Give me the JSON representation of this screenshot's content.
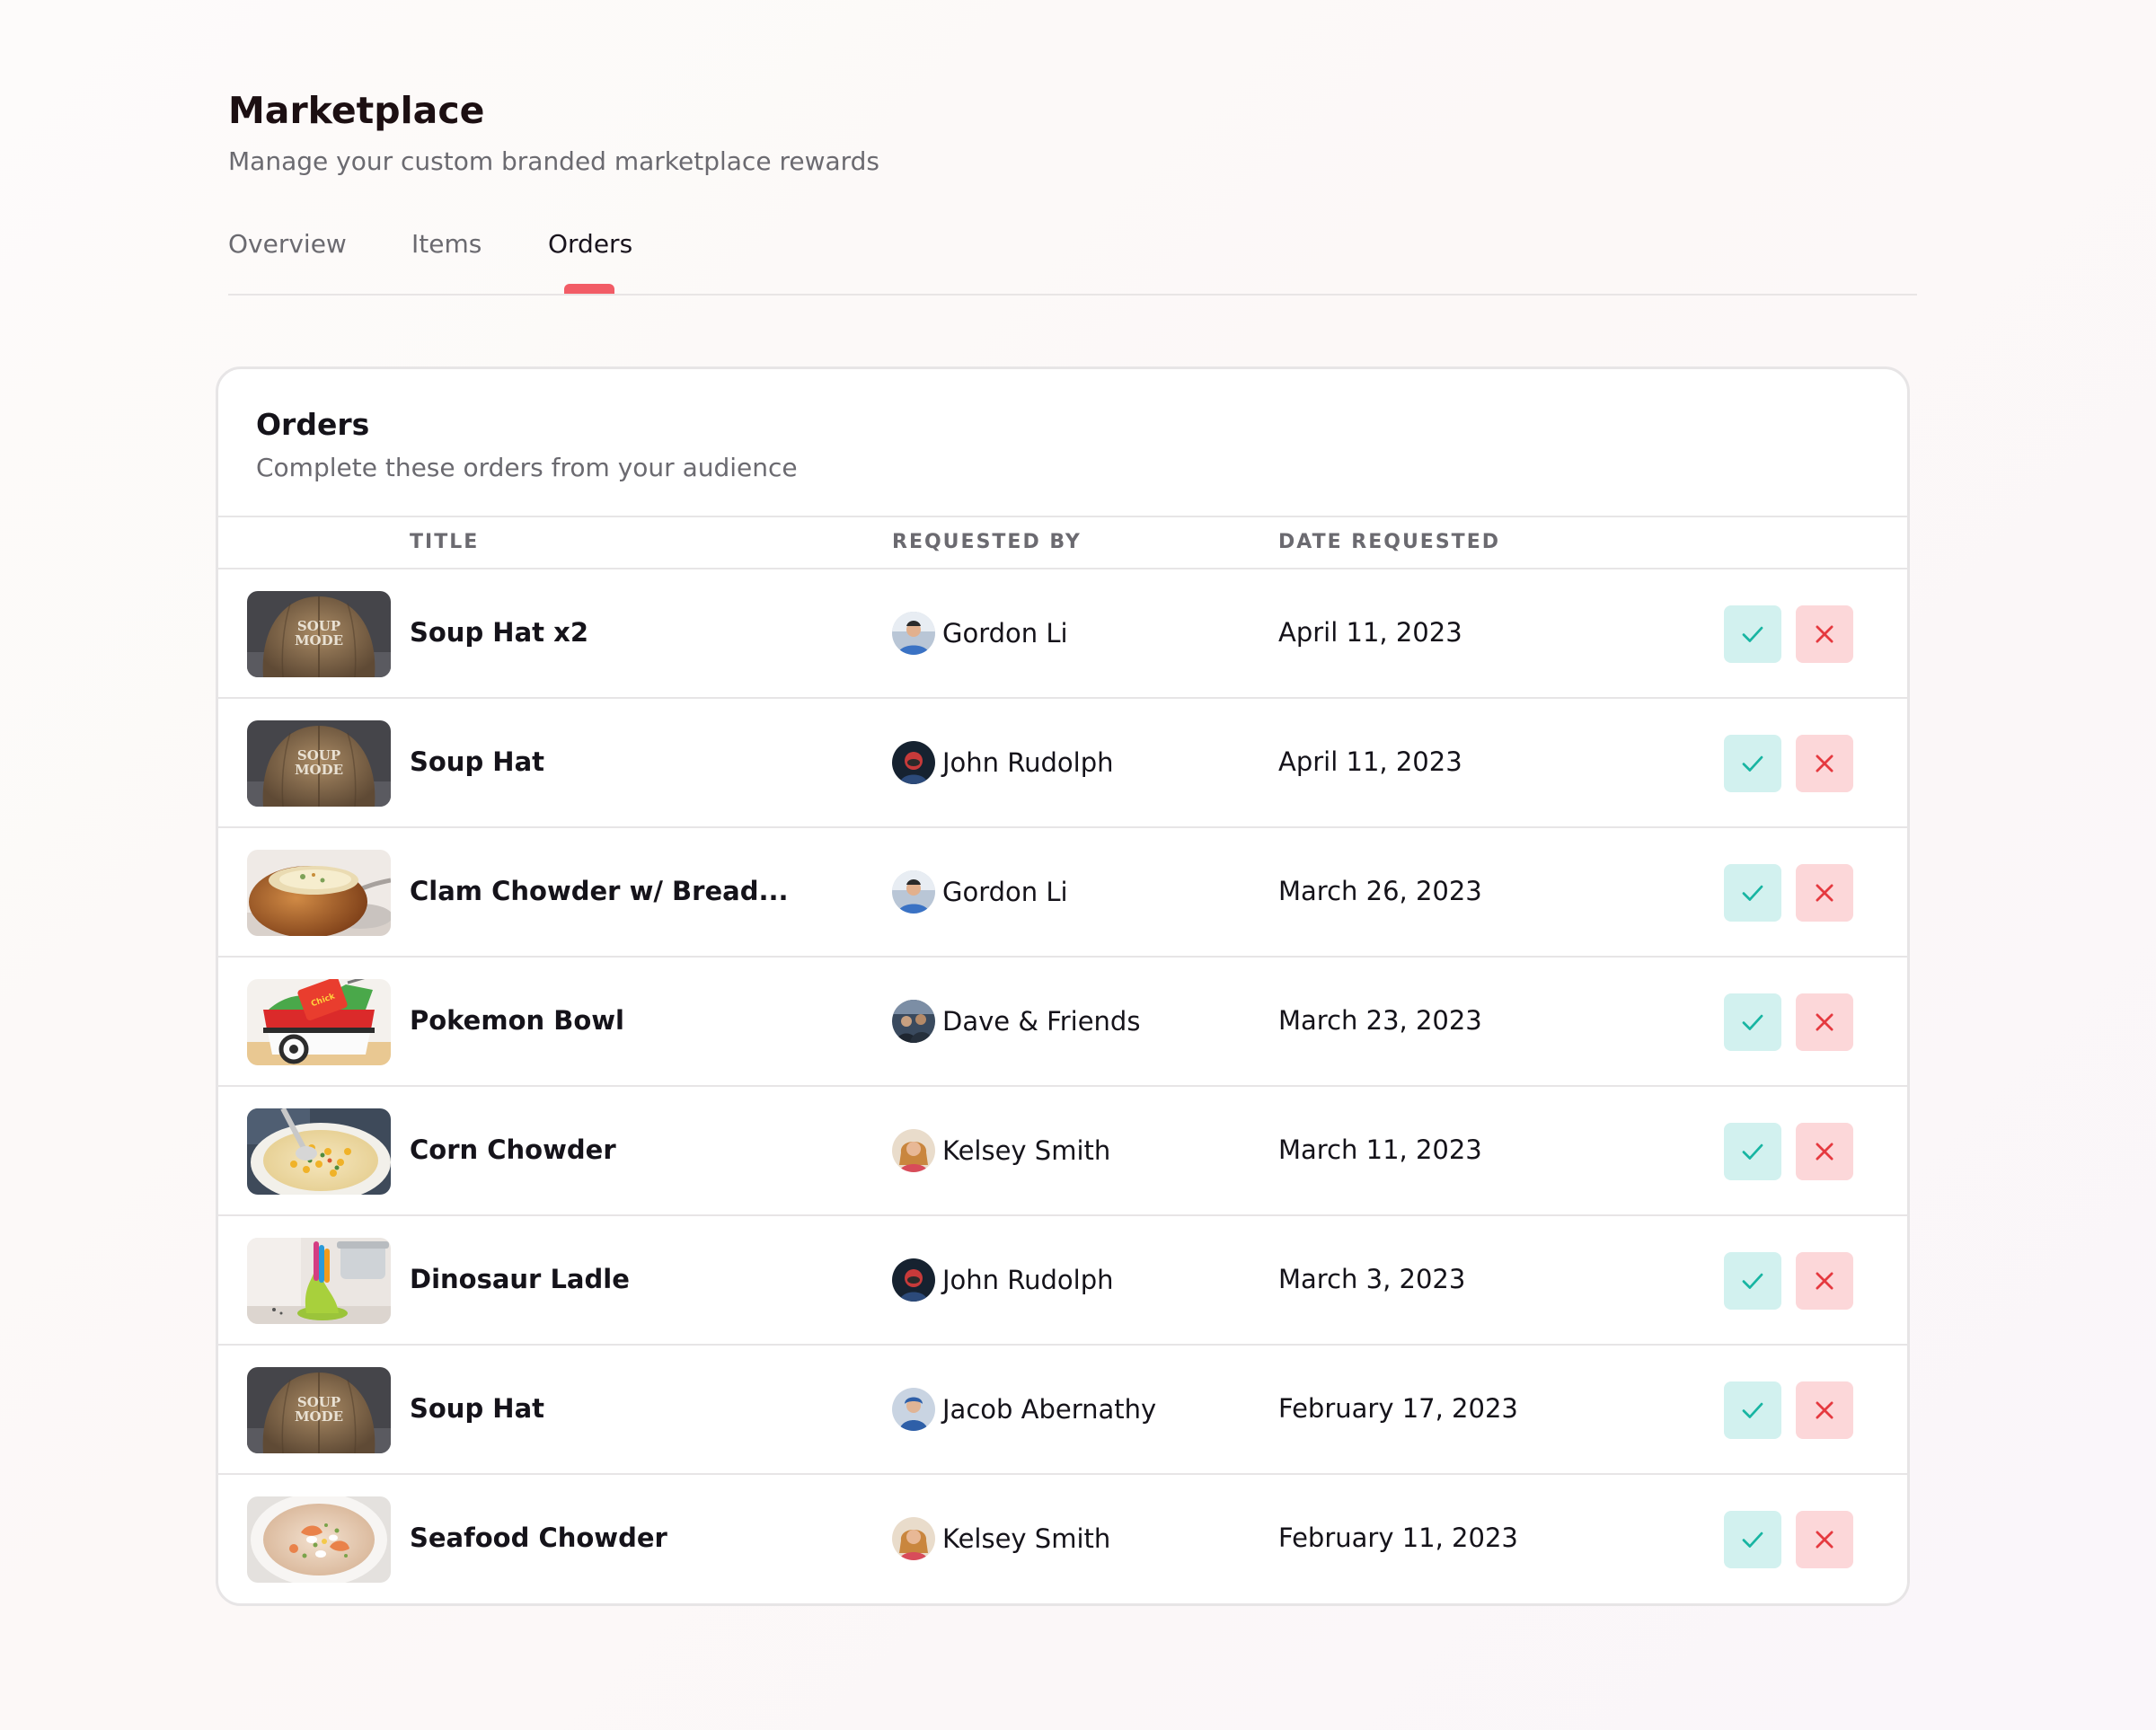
{
  "header": {
    "title": "Marketplace",
    "subtitle": "Manage your custom branded marketplace rewards"
  },
  "tabs": [
    {
      "label": "Overview",
      "active": false
    },
    {
      "label": "Items",
      "active": false
    },
    {
      "label": "Orders",
      "active": true
    }
  ],
  "colors": {
    "accent": "#f25c66",
    "approve_bg": "#d2f1ef",
    "approve_icon": "#18b5a2",
    "decline_bg": "#fcd7d9",
    "decline_icon": "#e5393f"
  },
  "orders_card": {
    "title": "Orders",
    "subtitle": "Complete these orders from your audience",
    "columns": {
      "title": "TITLE",
      "requested_by": "REQUESTED BY",
      "date_requested": "DATE REQUESTED"
    },
    "rows": [
      {
        "title": "Soup Hat x2",
        "requested_by": "Gordon Li",
        "date": "April 11, 2023",
        "thumbnail": "soup-hat-image",
        "avatar": "gordon-li-avatar"
      },
      {
        "title": "Soup Hat",
        "requested_by": "John Rudolph",
        "date": "April 11, 2023",
        "thumbnail": "soup-hat-image",
        "avatar": "john-rudolph-avatar"
      },
      {
        "title": "Clam Chowder w/ Bread...",
        "requested_by": "Gordon Li",
        "date": "March 26, 2023",
        "thumbnail": "clam-chowder-image",
        "avatar": "gordon-li-avatar"
      },
      {
        "title": "Pokemon Bowl",
        "requested_by": "Dave & Friends",
        "date": "March 23, 2023",
        "thumbnail": "pokemon-bowl-image",
        "avatar": "dave-friends-avatar"
      },
      {
        "title": "Corn Chowder",
        "requested_by": "Kelsey Smith",
        "date": "March 11, 2023",
        "thumbnail": "corn-chowder-image",
        "avatar": "kelsey-smith-avatar"
      },
      {
        "title": "Dinosaur Ladle",
        "requested_by": "John Rudolph",
        "date": "March 3, 2023",
        "thumbnail": "dinosaur-ladle-image",
        "avatar": "john-rudolph-avatar"
      },
      {
        "title": "Soup Hat",
        "requested_by": "Jacob Abernathy",
        "date": "February 17, 2023",
        "thumbnail": "soup-hat-image",
        "avatar": "jacob-abernathy-avatar"
      },
      {
        "title": "Seafood Chowder",
        "requested_by": "Kelsey Smith",
        "date": "February 11, 2023",
        "thumbnail": "seafood-chowder-image",
        "avatar": "kelsey-smith-avatar"
      }
    ],
    "actions": {
      "approve_icon": "check-icon",
      "decline_icon": "close-icon"
    }
  }
}
